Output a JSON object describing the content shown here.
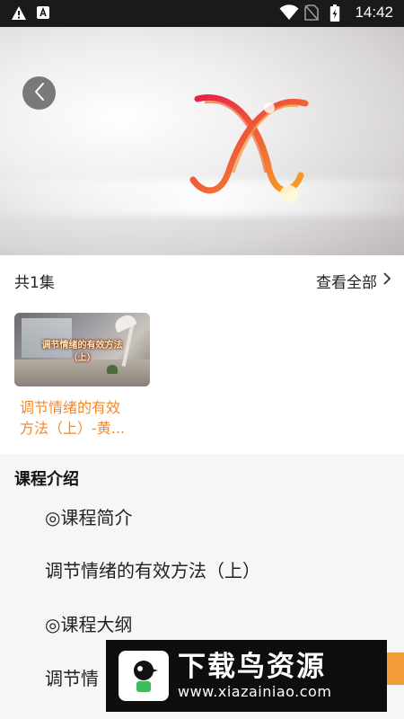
{
  "status_bar": {
    "time": "14:42",
    "left_icons": [
      "warning-icon",
      "a-notification-icon"
    ],
    "right_icons": [
      "wifi-icon",
      "no-sim-icon",
      "battery-icon"
    ]
  },
  "player": {
    "back_icon": "chevron-left-icon"
  },
  "episodes": {
    "count_label": "共1集",
    "view_all_label": "查看全部",
    "items": [
      {
        "thumb_title_line1": "调节情绪的有效方法",
        "thumb_title_line2": "（上）",
        "title_line1": "调节情绪的有效",
        "title_line2": "方法（上）-黄..."
      }
    ]
  },
  "intro": {
    "heading": "课程介绍",
    "lines": [
      "◎课程简介",
      "调节情绪的有效方法（上）",
      "◎课程大纲",
      "调节情"
    ]
  },
  "watermark": {
    "brand": "下载鸟资源",
    "url": "www.xiazainiao.com"
  },
  "colors": {
    "accent": "#f28a2c",
    "statusbar": "#1a1a1a"
  }
}
